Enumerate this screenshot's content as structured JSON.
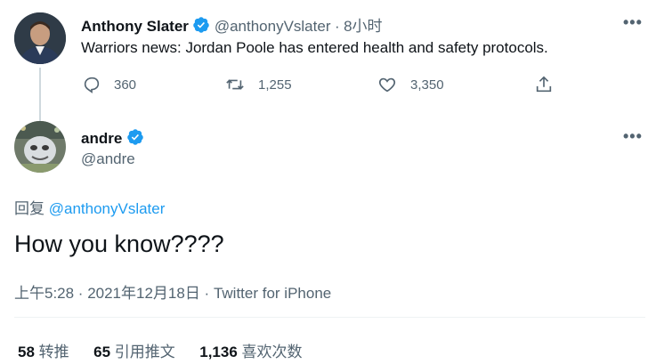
{
  "parent_tweet": {
    "display_name": "Anthony Slater",
    "handle": "@anthonyVslater",
    "separator": "·",
    "time": "8小时",
    "text": "Warriors news: Jordan Poole has entered health and safety protocols.",
    "replies": "360",
    "retweets": "1,255",
    "likes": "3,350"
  },
  "main_tweet": {
    "display_name": "andre",
    "handle": "@andre",
    "reply_prefix": "回复",
    "reply_to": "@anthonyVslater",
    "text": "How you know????",
    "timestamp": "上午5:28 · 2021年12月18日 · ",
    "source": "Twitter for iPhone"
  },
  "stats": {
    "retweets_count": "58",
    "retweets_label": "转推",
    "quotes_count": "65",
    "quotes_label": "引用推文",
    "likes_count": "1,136",
    "likes_label": "喜欢次数"
  },
  "colors": {
    "verified": "#1d9bf0",
    "link": "#1d9bf0",
    "muted": "#536471",
    "text": "#0f1419"
  }
}
